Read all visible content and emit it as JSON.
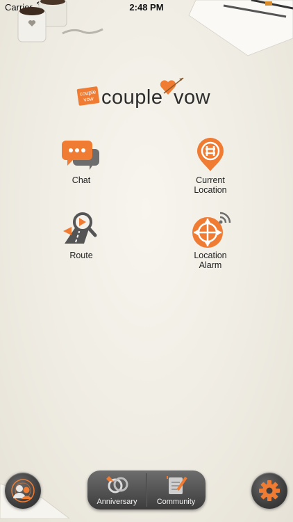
{
  "status_bar": {
    "carrier": "Carrier",
    "time": "2:48 PM"
  },
  "logo": {
    "badge_text_line1": "couple",
    "badge_text_line2": "vow",
    "word_left": "couple",
    "word_right": "vow"
  },
  "menu": {
    "chat_label": "Chat",
    "current_location_label_line1": "Current",
    "current_location_label_line2": "Location",
    "route_label": "Route",
    "location_alarm_label_line1": "Location",
    "location_alarm_label_line2": "Alarm"
  },
  "bottom_bar": {
    "anniversary_label": "Anniversary",
    "community_label": "Community"
  },
  "colors": {
    "accent": "#f07b32",
    "icon_gray": "#555555",
    "button_dark": "#3d3d3d"
  },
  "icons": {
    "chat": "chat-bubbles-icon",
    "current_location": "location-pin-icon",
    "route": "route-search-icon",
    "location_alarm": "location-alarm-icon",
    "profile": "couple-profile-icon",
    "settings": "gear-icon",
    "anniversary": "rings-icon",
    "community": "notebook-pen-icon"
  }
}
